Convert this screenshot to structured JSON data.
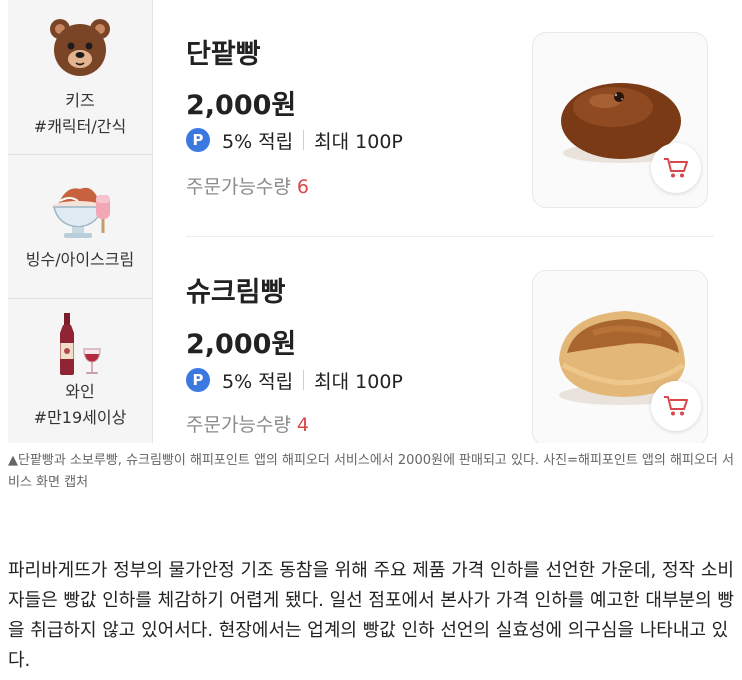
{
  "categories": [
    {
      "id": "kids",
      "line1": "키즈",
      "line2": "#캐릭터/간식",
      "icon": "bear-icon"
    },
    {
      "id": "bingsu",
      "line1": "빙수/아이스크림",
      "line2": "",
      "icon": "shaved-ice-icon"
    },
    {
      "id": "wine",
      "line1": "와인",
      "line2": "#만19세이상",
      "icon": "wine-icon"
    }
  ],
  "products": [
    {
      "name": "단팥빵",
      "price": "2,000원",
      "points_badge": "P",
      "points_rate": "5% 적립",
      "points_max": "최대 100P",
      "qty_label": "주문가능수량",
      "qty_value": "6",
      "image": "red-bean-bread"
    },
    {
      "name": "슈크림빵",
      "price": "2,000원",
      "points_badge": "P",
      "points_rate": "5% 적립",
      "points_max": "최대 100P",
      "qty_label": "주문가능수량",
      "qty_value": "4",
      "image": "cream-bread"
    }
  ],
  "caption": "▲단팥빵과 소보루빵, 슈크림빵이 해피포인트 앱의 해피오더 서비스에서 2000원에 판매되고 있다. 사진=해피포인트 앱의 해피오더 서비스 화면 캡처",
  "article": "파리바게뜨가 정부의 물가안정 기조 동참을 위해 주요 제품 가격 인하를 선언한 가운데, 정작 소비자들은 빵값 인하를 체감하기 어렵게 됐다. 일선 점포에서 본사가 가격 인하를 예고한 대부분의 빵을 취급하지 않고 있어서다. 현장에서는 업계의 빵값 인하 선언의 실효성에 의구심을 나타내고 있다.",
  "colors": {
    "points_badge": "#3b78e0",
    "qty_value": "#d9474c",
    "cart_icon": "#d9474c",
    "sidebar_bg": "#f5f5f5"
  }
}
